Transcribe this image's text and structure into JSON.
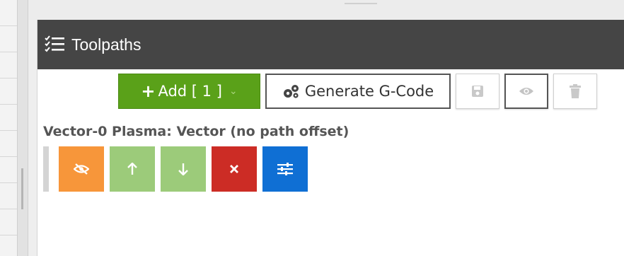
{
  "panel": {
    "title": "Toolpaths"
  },
  "toolbar": {
    "add_label": "Add [ 1 ]",
    "generate_label": "Generate G-Code"
  },
  "operation": {
    "title": "Vector-0 Plasma: Vector (no path offset)"
  },
  "icons": {
    "header": "checklist-icon",
    "add": "plus-icon",
    "add_caret": "chevron-down-icon",
    "generate": "gears-icon",
    "save": "floppy-disk-icon",
    "preview": "eye-icon",
    "delete": "trash-icon",
    "op_hide": "eye-slash-icon",
    "op_up": "arrow-up-icon",
    "op_down": "arrow-down-icon",
    "op_remove": "x-icon",
    "op_settings": "sliders-icon"
  },
  "colors": {
    "header_bg": "#454545",
    "add_green": "#5aa119",
    "hide_orange": "#f7963a",
    "move_green": "#9ccb7a",
    "remove_red": "#cc2c25",
    "settings_blue": "#0f6fd4"
  }
}
